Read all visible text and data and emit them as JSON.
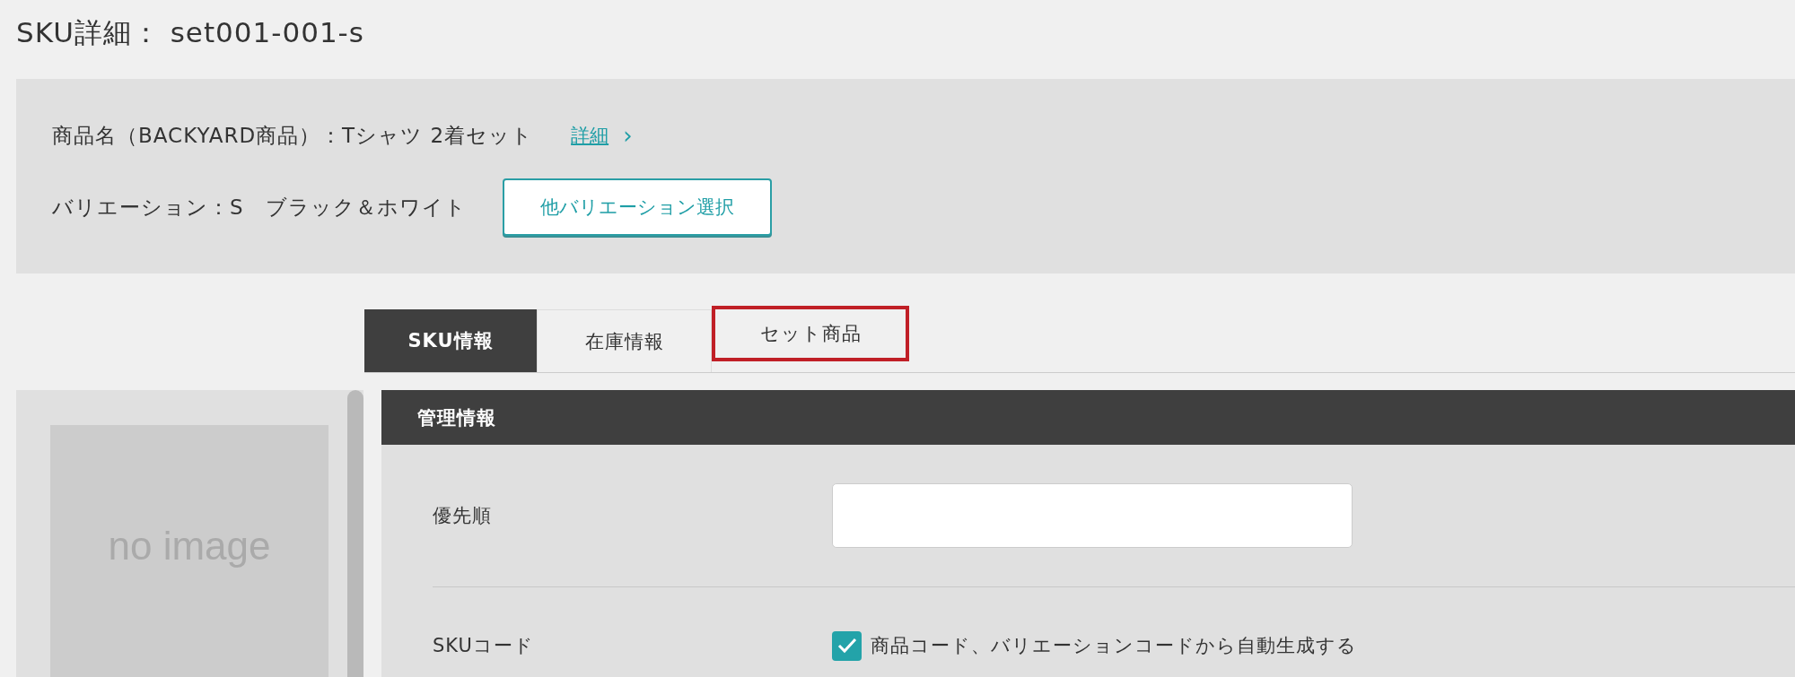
{
  "page_title": "SKU詳細： set001-001-s",
  "product": {
    "name_line": "商品名（BACKYARD商品）：Tシャツ 2着セット",
    "detail_link": "詳細",
    "chevron": "›",
    "variation_line": "バリエーション：S　ブラック＆ホワイト",
    "variation_button": "他バリエーション選択"
  },
  "tabs": [
    {
      "label": "SKU情報",
      "selected": true,
      "highlighted": false
    },
    {
      "label": "在庫情報",
      "selected": false,
      "highlighted": false
    },
    {
      "label": "セット商品",
      "selected": false,
      "highlighted": true
    }
  ],
  "image_placeholder": "no image",
  "section": {
    "title": "管理情報",
    "rows": [
      {
        "kind": "input",
        "label": "優先順",
        "value": ""
      },
      {
        "kind": "checkbox",
        "label": "SKUコード",
        "option": "商品コード、バリエーションコードから自動生成する",
        "checked": true
      }
    ]
  }
}
